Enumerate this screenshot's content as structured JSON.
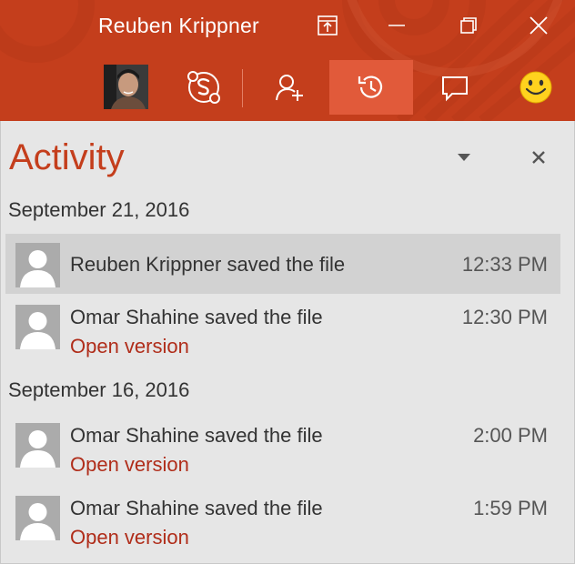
{
  "window": {
    "title": "Reuben Krippner"
  },
  "colors": {
    "accent": "#c43e1c",
    "active_tab": "#e15a3a",
    "link": "#b02d1a",
    "panel_bg": "#e6e6e6",
    "selected_row": "#d2d2d2"
  },
  "toolbar": {
    "icons": [
      "avatar",
      "skype-icon",
      "add-person-icon",
      "history-icon",
      "comment-icon",
      "smiley-icon"
    ],
    "active": "history-icon"
  },
  "panel": {
    "title": "Activity"
  },
  "groups": [
    {
      "date": "September 21, 2016",
      "items": [
        {
          "text": "Reuben Krippner saved the file",
          "time": "12:33 PM",
          "link": ""
        },
        {
          "text": "Omar Shahine saved the file",
          "time": "12:30 PM",
          "link": "Open version"
        }
      ]
    },
    {
      "date": "September 16, 2016",
      "items": [
        {
          "text": "Omar Shahine saved the file",
          "time": "2:00 PM",
          "link": "Open version"
        },
        {
          "text": "Omar Shahine saved the file",
          "time": "1:59 PM",
          "link": "Open version"
        }
      ]
    }
  ]
}
